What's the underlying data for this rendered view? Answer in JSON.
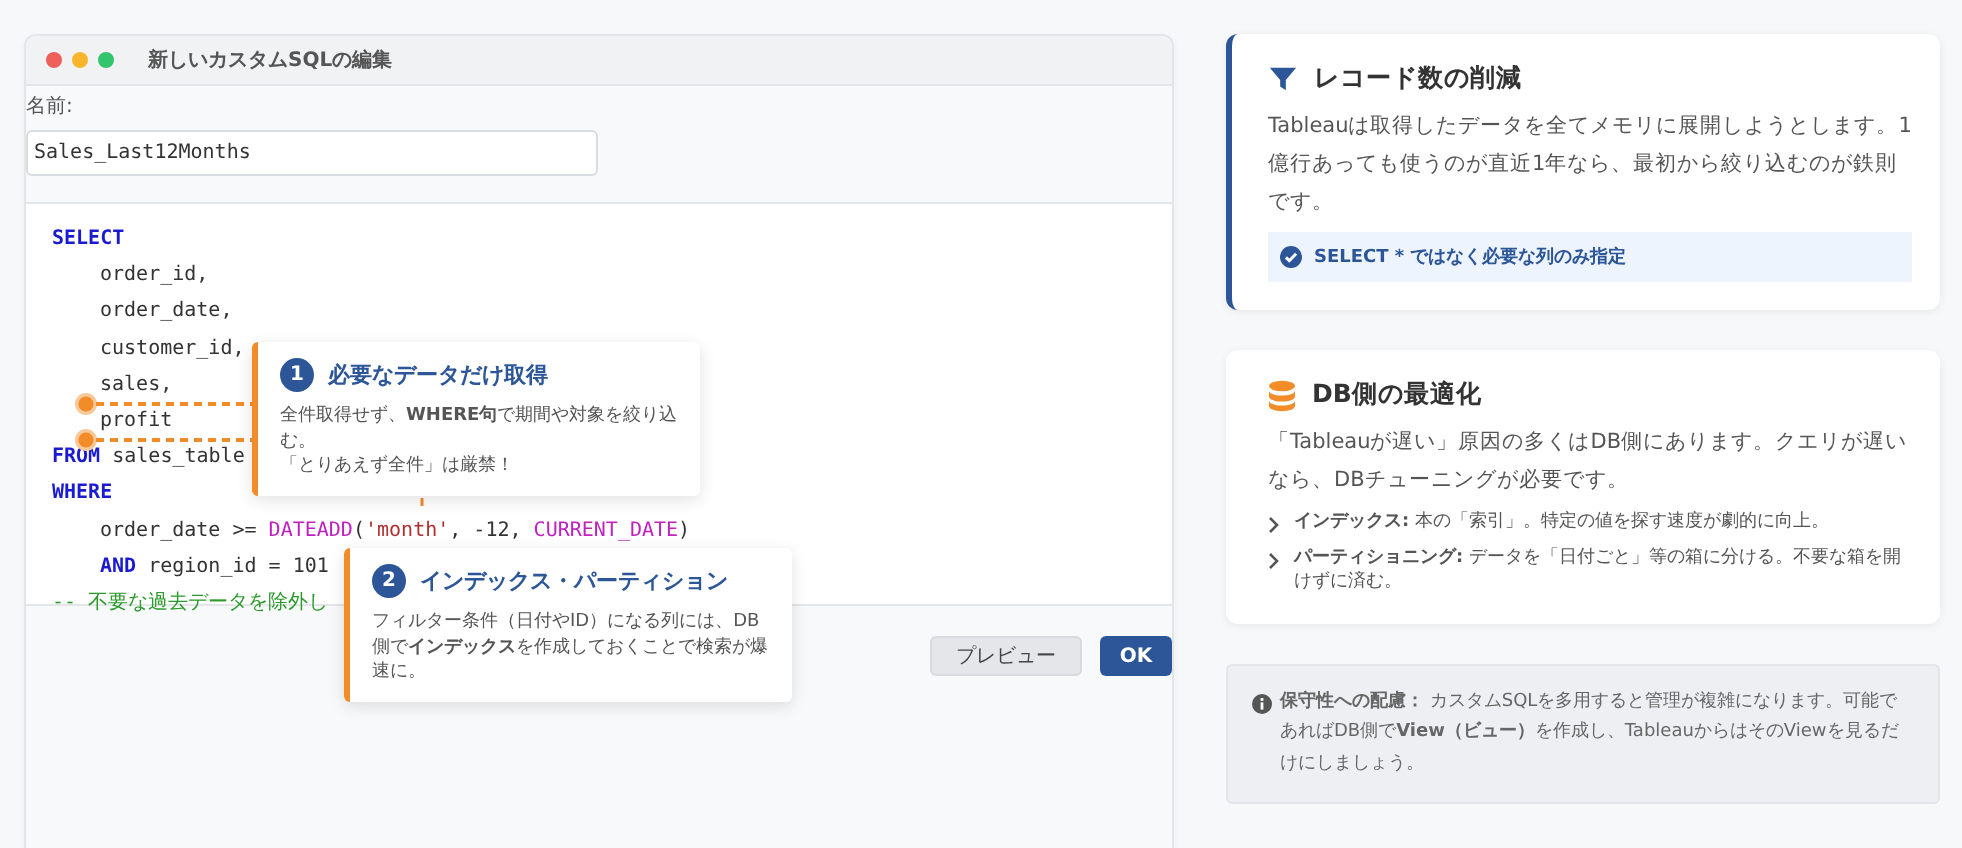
{
  "window": {
    "title": "新しいカスタムSQLの編集",
    "name_label": "名前:",
    "name_value": "Sales_Last12Months",
    "code_lines": [
      {
        "indent": false,
        "tokens": [
          {
            "kind": "keyword",
            "text": "SELECT"
          }
        ]
      },
      {
        "indent": true,
        "tokens": [
          {
            "kind": "plain",
            "text": "order_id,"
          }
        ]
      },
      {
        "indent": true,
        "tokens": [
          {
            "kind": "plain",
            "text": "order_date,"
          }
        ]
      },
      {
        "indent": true,
        "tokens": [
          {
            "kind": "plain",
            "text": "customer_id,"
          }
        ]
      },
      {
        "indent": true,
        "tokens": [
          {
            "kind": "plain",
            "text": "sales,"
          }
        ]
      },
      {
        "indent": true,
        "tokens": [
          {
            "kind": "plain",
            "text": "profit"
          }
        ]
      },
      {
        "indent": false,
        "tokens": [
          {
            "kind": "keyword",
            "text": "FROM"
          },
          {
            "kind": "plain",
            "text": " sales_table"
          }
        ]
      },
      {
        "indent": false,
        "tokens": [
          {
            "kind": "keyword",
            "text": "WHERE"
          }
        ]
      },
      {
        "indent": true,
        "tokens": [
          {
            "kind": "plain",
            "text": "order_date >= "
          },
          {
            "kind": "function",
            "text": "DATEADD"
          },
          {
            "kind": "plain",
            "text": "("
          },
          {
            "kind": "string",
            "text": "'month'"
          },
          {
            "kind": "plain",
            "text": ", -12, "
          },
          {
            "kind": "function",
            "text": "CURRENT_DATE"
          },
          {
            "kind": "plain",
            "text": ")"
          }
        ]
      },
      {
        "indent": true,
        "tokens": [
          {
            "kind": "keyword",
            "text": "AND"
          },
          {
            "kind": "plain",
            "text": " region_id = 101"
          }
        ]
      },
      {
        "indent": false,
        "tokens": [
          {
            "kind": "comment",
            "text": "-- 不要な過去データを除外し"
          }
        ]
      }
    ],
    "buttons": [
      {
        "label": "プレビュー",
        "kind": "secondary"
      },
      {
        "label": "OK",
        "kind": "primary"
      }
    ]
  },
  "callouts": [
    {
      "number": "1",
      "title": "必要なデータだけ取得",
      "body": [
        "全件取得せず、**WHERE句**で期間や対象を絞り込む。",
        "「とりあえず全件」は厳禁！"
      ]
    },
    {
      "number": "2",
      "title": "インデックス・パーティション",
      "body": [
        "フィルター条件（日付やID）になる列には、DB側で**インデックス**を作成しておくことで検索が爆速に。"
      ]
    }
  ],
  "cards": [
    {
      "accent": true,
      "title": "レコード数の削減",
      "body": "Tableauは取得したデータを全てメモリに展開しようとします。1億行あっても使うのが直近1年なら、最初から絞り込むのが鉄則です。",
      "tip": "SELECT * ではなく必要な列のみ指定"
    },
    {
      "accent": false,
      "title": "DB側の最適化",
      "body": "「Tableauが遅い」原因の多くはDB側にあります。クエリが遅いなら、DBチューニングが必要です。",
      "bullets": [
        "**インデックス:** 本の「索引」。特定の値を探す速度が劇的に向上。",
        "**パーティショニング:** データを「日付ごと」等の箱に分ける。不要な箱を開けずに済む。"
      ]
    }
  ],
  "note": {
    "text": "**保守性への配慮：** カスタムSQLを多用すると管理が複雑になります。可能であればDB側で**View（ビュー）**を作成し、TableauからはそのViewを見るだけにしましょう。"
  }
}
